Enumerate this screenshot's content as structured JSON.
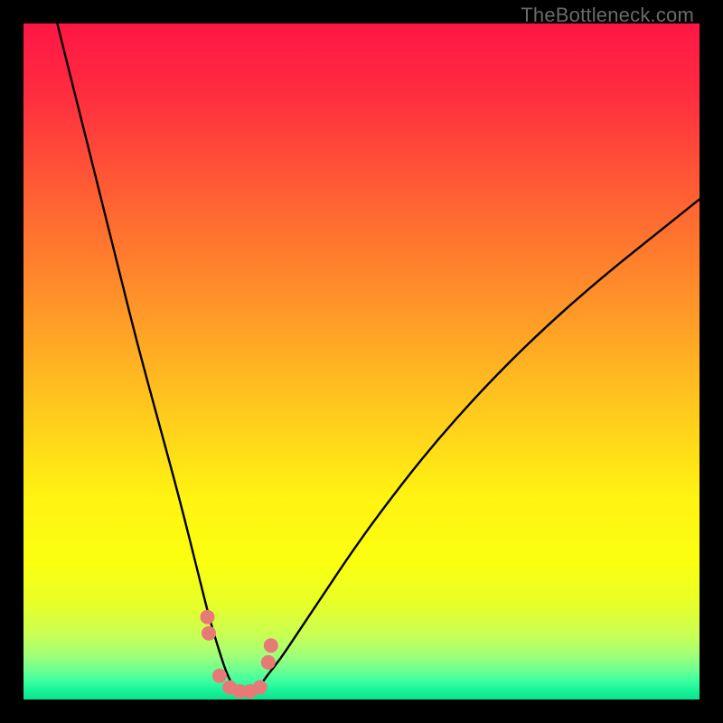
{
  "watermark": {
    "text": "TheBottleneck.com"
  },
  "colors": {
    "black": "#000000",
    "curve": "#000000",
    "dots": "#e77a77",
    "gradient_stops": [
      {
        "offset": 0.0,
        "color": "#ff1745"
      },
      {
        "offset": 0.1,
        "color": "#ff2b40"
      },
      {
        "offset": 0.25,
        "color": "#ff5e33"
      },
      {
        "offset": 0.4,
        "color": "#ff8f2a"
      },
      {
        "offset": 0.55,
        "color": "#ffc21f"
      },
      {
        "offset": 0.7,
        "color": "#fff312"
      },
      {
        "offset": 0.8,
        "color": "#fbff10"
      },
      {
        "offset": 0.86,
        "color": "#e6ff2a"
      },
      {
        "offset": 0.905,
        "color": "#c8ff55"
      },
      {
        "offset": 0.935,
        "color": "#a0ff78"
      },
      {
        "offset": 0.955,
        "color": "#70ff8f"
      },
      {
        "offset": 0.972,
        "color": "#3effa0"
      },
      {
        "offset": 0.985,
        "color": "#1bf59a"
      },
      {
        "offset": 1.0,
        "color": "#0ae28f"
      }
    ]
  },
  "chart_data": {
    "type": "line",
    "title": "",
    "xlabel": "",
    "ylabel": "",
    "xlim": [
      0,
      100
    ],
    "ylim": [
      0,
      100
    ],
    "series": [
      {
        "name": "bottleneck-curve",
        "type": "line",
        "x": [
          5,
          8,
          11,
          14,
          17,
          20,
          23,
          26,
          27.5,
          29,
          30,
          31,
          32,
          33,
          34,
          35,
          36,
          38,
          40,
          44,
          48,
          53,
          60,
          68,
          76,
          85,
          95,
          100
        ],
        "y": [
          100,
          88,
          76,
          64,
          52,
          41,
          30,
          18,
          12,
          7,
          4,
          2,
          1,
          0.7,
          1,
          2,
          3.5,
          6,
          9,
          15,
          21,
          28,
          37,
          46,
          54,
          62,
          70,
          74
        ]
      },
      {
        "name": "trough-dots",
        "type": "scatter",
        "x": [
          27.2,
          27.4,
          29.0,
          30.5,
          32.0,
          33.5,
          35.0,
          36.2,
          36.6
        ],
        "y": [
          12.2,
          9.8,
          3.5,
          1.8,
          1.2,
          1.2,
          1.8,
          5.5,
          8.0
        ]
      }
    ]
  }
}
